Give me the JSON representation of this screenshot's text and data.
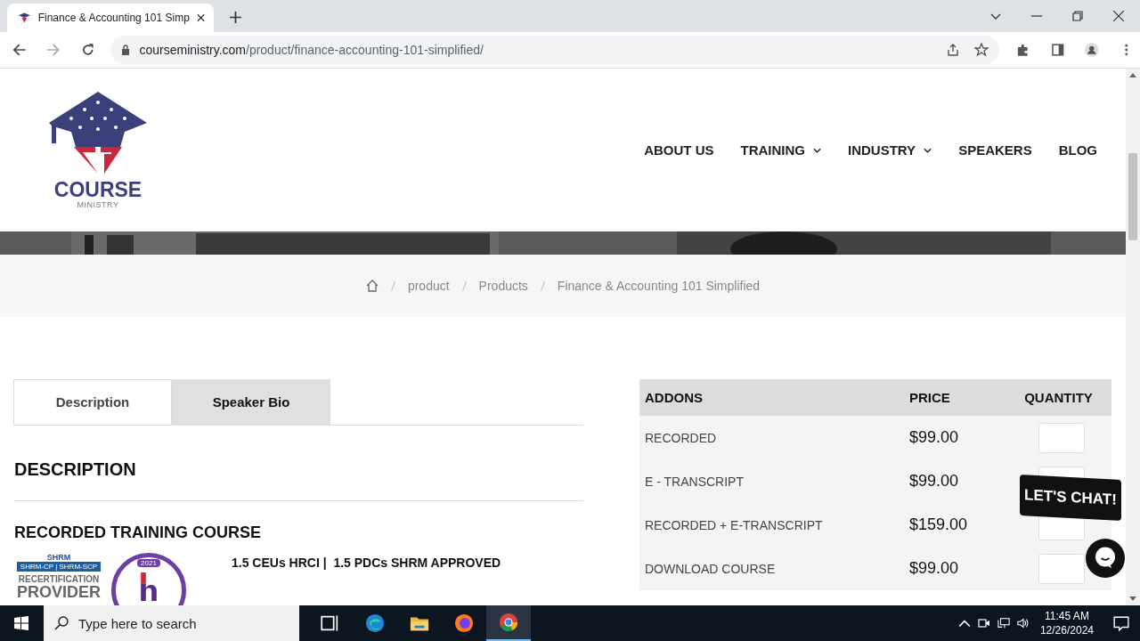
{
  "browser": {
    "tab_title": "Finance & Accounting 101 Simp",
    "url_domain": "courseministry.com",
    "url_path": "/product/finance-accounting-101-simplified/"
  },
  "site": {
    "logo_word": "COURSE",
    "logo_sub": "MINISTRY",
    "nav": [
      {
        "label": "ABOUT US",
        "dropdown": false
      },
      {
        "label": "TRAINING",
        "dropdown": true
      },
      {
        "label": "INDUSTRY",
        "dropdown": true
      },
      {
        "label": "SPEAKERS",
        "dropdown": false
      },
      {
        "label": "BLOG",
        "dropdown": false
      }
    ]
  },
  "breadcrumb": [
    "product",
    "Products",
    "Finance & Accounting 101 Simplified"
  ],
  "tabs": [
    {
      "label": "Description",
      "selected": true
    },
    {
      "label": "Speaker Bio",
      "selected": false
    }
  ],
  "description_heading": "DESCRIPTION",
  "course_heading": "RECORDED TRAINING COURSE",
  "shrm_badge": {
    "title": "SHRM",
    "subtitle": "SHRM-CP | SHRM-SCP",
    "line1": "RECERTIFICATION",
    "line2": "PROVIDER"
  },
  "hrci_badge": {
    "year": "2021"
  },
  "credits": "1.5 CEUs HRCI |  1.5 PDCs SHRM APPROVED",
  "addons": {
    "columns": [
      "ADDONS",
      "PRICE",
      "QUANTITY"
    ],
    "rows": [
      {
        "name": "RECORDED",
        "price": "$99.00"
      },
      {
        "name": "E - TRANSCRIPT",
        "price": "$99.00"
      },
      {
        "name": "RECORDED + E-TRANSCRIPT",
        "price": "$159.00"
      },
      {
        "name": "DOWNLOAD COURSE",
        "price": "$99.00"
      }
    ]
  },
  "chat": {
    "label": "LET'S CHAT!"
  },
  "taskbar": {
    "search_placeholder": "Type here to search",
    "time": "11:45 AM",
    "date": "12/26/2024"
  }
}
